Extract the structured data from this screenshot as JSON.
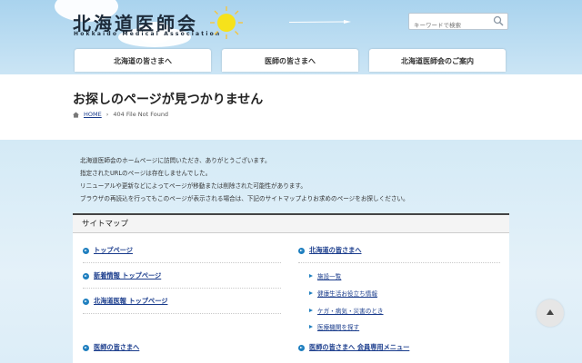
{
  "header": {
    "logo_title": "北海道医師会",
    "logo_sub": "Hokkaido Medical Association",
    "search_placeholder": "キーワードで検索"
  },
  "nav": {
    "items": [
      "北海道の皆さまへ",
      "医師の皆さまへ",
      "北海道医師会のご案内"
    ]
  },
  "page": {
    "title": "お探しのページが見つかりません",
    "breadcrumb_home": "HOME",
    "breadcrumb_sep": "›",
    "breadcrumb_current": "404 File Not Found"
  },
  "intro": [
    "北海道医師会のホームページに訪問いただき、ありがとうございます。",
    "指定されたURLのページは存在しませんでした。",
    "リニューアルや更新などによってページが移動または削除された可能性があります。",
    "ブラウザの再読込を行ってもこのページが表示される場合は、下記のサイトマップよりお求めのページをお探しください。"
  ],
  "sitemap": {
    "heading": "サイトマップ",
    "left": [
      "トップページ",
      "新着情報 トップページ",
      "北海道医報 トップページ",
      "医師の皆さまへ"
    ],
    "right_main": "北海道の皆さまへ",
    "right_sub": [
      "施設一覧",
      "健康生活お役立ち情報",
      "ケガ・病気・災害のとき",
      "医療機関を探す"
    ],
    "right_bottom": "医師の皆さまへ 会員専用メニュー"
  },
  "colors": {
    "link": "#1a3c8c",
    "accent": "#1f7fbf",
    "sky": "#a9d3ee"
  }
}
